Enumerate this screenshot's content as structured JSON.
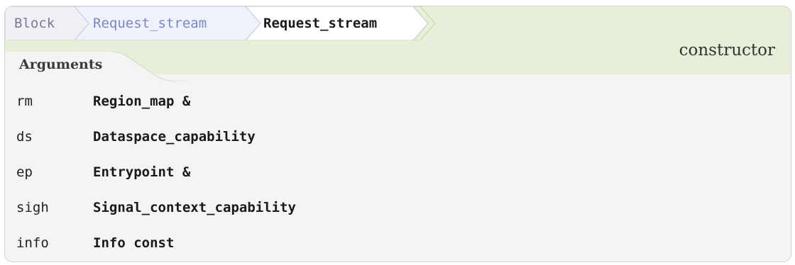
{
  "breadcrumb": {
    "block_label": "Block",
    "parent_label": "Request_stream",
    "current_label": "Request_stream"
  },
  "member_kind": "constructor",
  "arguments": {
    "title": "Arguments",
    "items": [
      {
        "name": "rm",
        "type": "Region_map &"
      },
      {
        "name": "ds",
        "type": "Dataspace_capability"
      },
      {
        "name": "ep",
        "type": "Entrypoint &"
      },
      {
        "name": "sigh",
        "type": "Signal_context_capability"
      },
      {
        "name": "info",
        "type": "Info const"
      }
    ]
  },
  "colors": {
    "header_green": "#e6efd8",
    "breadcrumb_block": "#eef0f6",
    "breadcrumb_link": "#eef2fa",
    "body_gray": "#f4f4f4",
    "link_text": "#7d87c2"
  }
}
